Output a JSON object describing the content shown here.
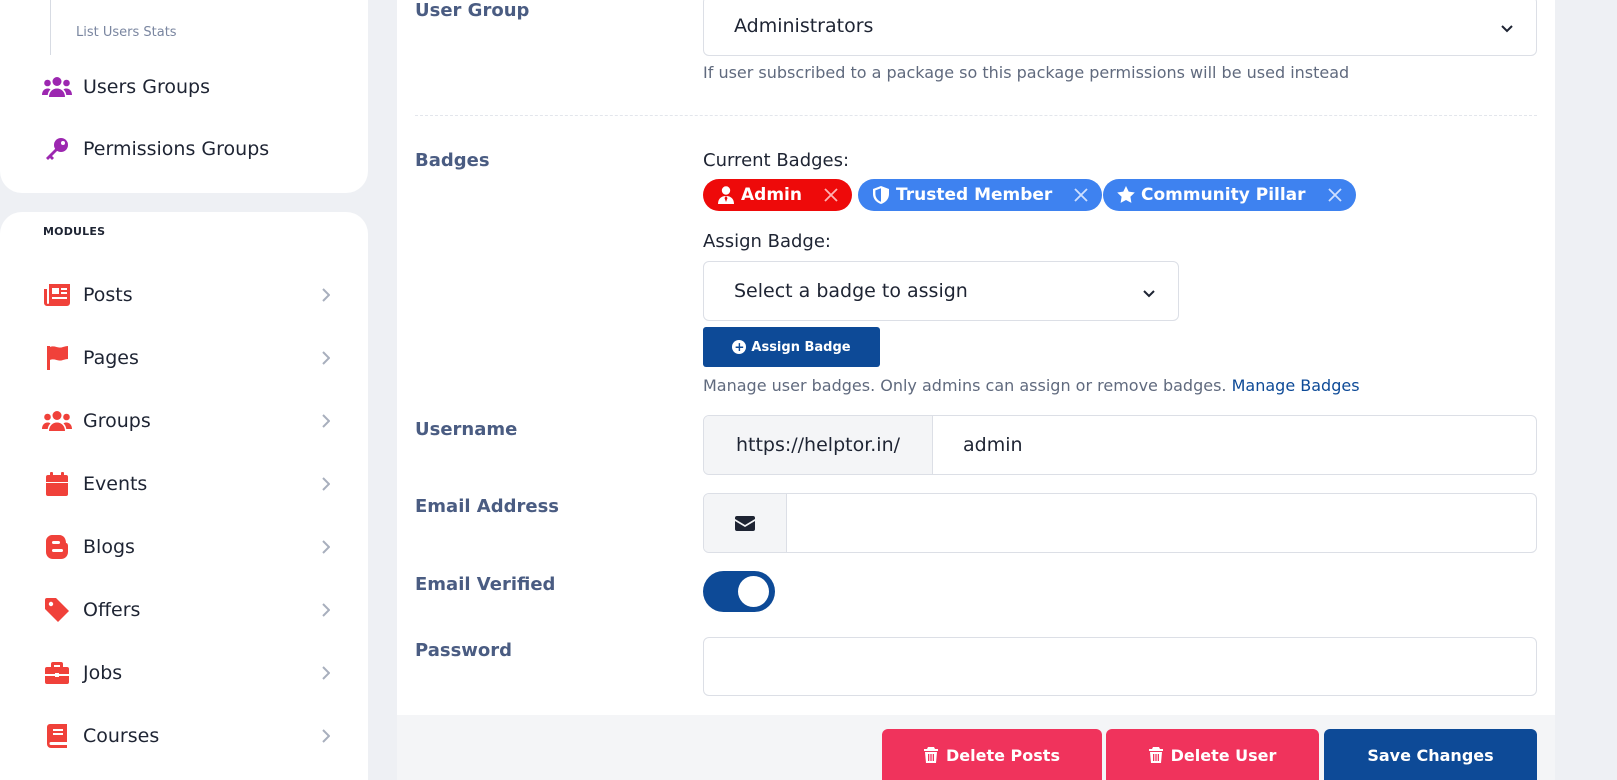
{
  "sidebar": {
    "sub_item": "List Users Stats",
    "top_items": [
      {
        "label": "Users Groups",
        "icon": "users-icon"
      },
      {
        "label": "Permissions Groups",
        "icon": "key-icon"
      }
    ],
    "modules_title": "MODULES",
    "modules": [
      {
        "label": "Posts",
        "icon": "newspaper-icon"
      },
      {
        "label": "Pages",
        "icon": "flag-icon"
      },
      {
        "label": "Groups",
        "icon": "users-icon"
      },
      {
        "label": "Events",
        "icon": "calendar-icon"
      },
      {
        "label": "Blogs",
        "icon": "blogger-icon"
      },
      {
        "label": "Offers",
        "icon": "tag-icon"
      },
      {
        "label": "Jobs",
        "icon": "briefcase-icon"
      },
      {
        "label": "Courses",
        "icon": "book-icon"
      }
    ]
  },
  "form": {
    "user_group": {
      "label": "User Group",
      "value": "Administrators",
      "help": "If user subscribed to a package so this package permissions will be used instead"
    },
    "badges": {
      "label": "Badges",
      "current_label": "Current Badges:",
      "items": [
        {
          "name": "Admin",
          "icon": "user-tie-icon",
          "color": "#ee0a0a"
        },
        {
          "name": "Trusted Member",
          "icon": "shield-icon",
          "color": "#3e82f0"
        },
        {
          "name": "Community Pillar",
          "icon": "star-icon",
          "color": "#3e82f0"
        }
      ],
      "assign_label": "Assign Badge:",
      "select_placeholder": "Select a badge to assign",
      "assign_button": "Assign Badge",
      "help": "Manage user badges. Only admins can assign or remove badges.",
      "help_link": "Manage Badges"
    },
    "username": {
      "label": "Username",
      "prefix": "https://helptor.in/",
      "value": "admin"
    },
    "email": {
      "label": "Email Address",
      "value": "",
      "icon": "envelope-icon"
    },
    "email_verified": {
      "label": "Email Verified",
      "enabled": true
    },
    "password": {
      "label": "Password",
      "value": ""
    }
  },
  "actions": {
    "delete_posts": "Delete Posts",
    "delete_user": "Delete User",
    "save": "Save Changes"
  },
  "colors": {
    "primary": "#0d4a97",
    "danger": "#f0335c",
    "label": "#4a5c82",
    "sidebar_icon": "#f0413a",
    "top_icon": "#9c27b0"
  }
}
